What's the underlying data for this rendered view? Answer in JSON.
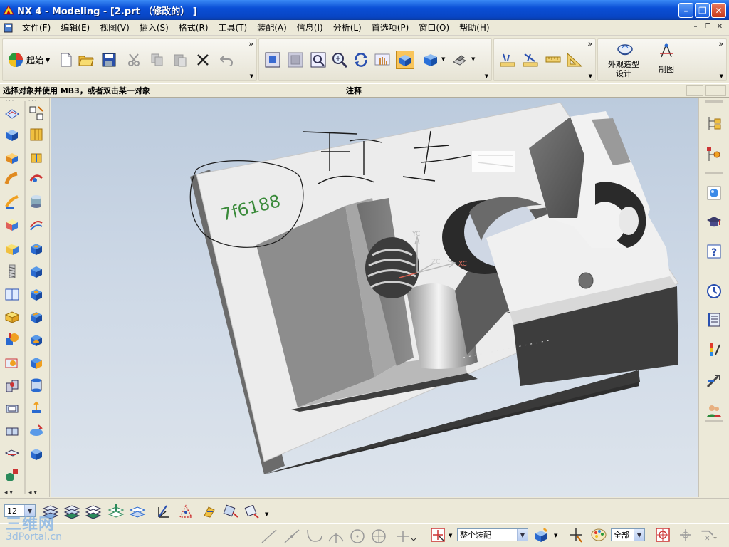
{
  "window": {
    "title": "NX 4 - Modeling - [2.prt （修改的） ]",
    "minimize_label": "–",
    "maximize_label": "❐",
    "close_label": "✕"
  },
  "menu": {
    "items": [
      {
        "label": "文件(F)"
      },
      {
        "label": "编辑(E)"
      },
      {
        "label": "视图(V)"
      },
      {
        "label": "插入(S)"
      },
      {
        "label": "格式(R)"
      },
      {
        "label": "工具(T)"
      },
      {
        "label": "装配(A)"
      },
      {
        "label": "信息(I)"
      },
      {
        "label": "分析(L)"
      },
      {
        "label": "首选项(P)"
      },
      {
        "label": "窗口(O)"
      },
      {
        "label": "帮助(H)"
      }
    ]
  },
  "toolbar": {
    "start_label": "起始",
    "more_glyph": "»",
    "appearance_design_label_1": "外观造型",
    "appearance_design_label_2": "设计",
    "drafting_label": "制图"
  },
  "prompt": {
    "message": "选择对象并使用 MB3，或者双击某一对象",
    "status": "注释"
  },
  "viewport": {
    "annotation_text": "7f6188",
    "axis_labels": {
      "yc": "YC",
      "zc": "ZC",
      "xc": "XC"
    }
  },
  "bottom": {
    "layer_value": "12",
    "assembly_filter_value": "整个装配",
    "type_filter_value": "全部"
  },
  "watermark": {
    "line1": "三维网",
    "line2": "3dPortal.cn"
  },
  "colors": {
    "titlebar": "#0a4fd6",
    "viewport_top": "#bccbdd",
    "active_button": "#f9c55b",
    "part_light": "#ebebeb",
    "part_dark": "#3a3a3a"
  }
}
